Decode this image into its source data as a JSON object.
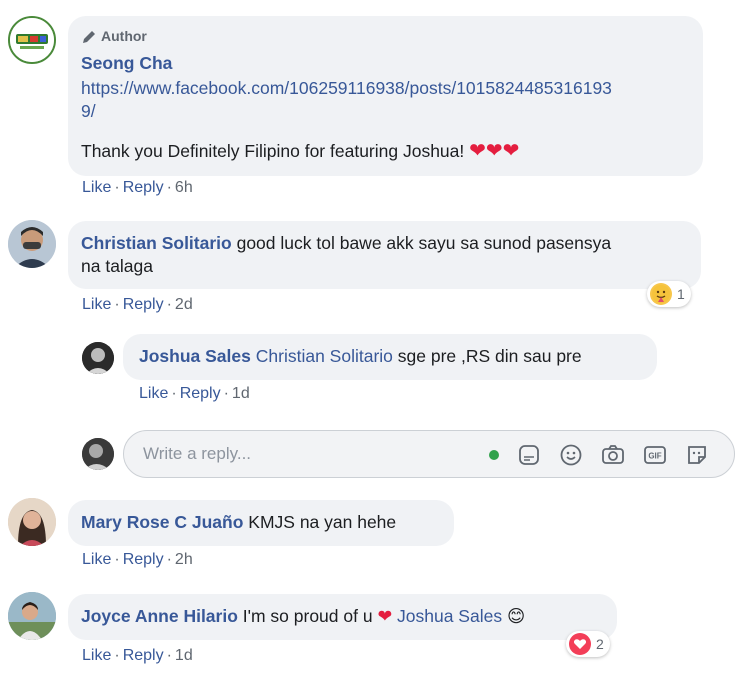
{
  "comments": [
    {
      "author_badge": "Author",
      "name": "Seong Cha",
      "link_line1": "https://www.facebook.com/106259116938/posts/1015824485316193",
      "link_line2": "9/",
      "text": "Thank you Definitely Filipino for featuring Joshua!",
      "hearts": "❤❤❤",
      "like": "Like",
      "reply": "Reply",
      "time": "6h"
    },
    {
      "name": "Christian Solitario",
      "text_line1": "good luck tol bawe akk sayu sa sunod pasensya",
      "text_line2": "na talaga",
      "like": "Like",
      "reply": "Reply",
      "time": "2d",
      "reaction_count": "1",
      "reply_item": {
        "name": "Joshua Sales",
        "mention": "Christian Solitario",
        "text": "sge pre ,RS din sau pre",
        "like": "Like",
        "reply": "Reply",
        "time": "1d"
      }
    },
    {
      "name": "Mary Rose C Juaño",
      "text": "KMJS na yan hehe",
      "like": "Like",
      "reply": "Reply",
      "time": "2h"
    },
    {
      "name": "Joyce Anne Hilario",
      "text": "I'm so proud of u",
      "heart": "❤",
      "mention": "Joshua Sales",
      "emoji": "😊",
      "like": "Like",
      "reply": "Reply",
      "time": "1d",
      "reaction_count": "2"
    }
  ],
  "reply_box": {
    "placeholder": "Write a reply...",
    "icons": [
      "sticker-icon",
      "emoji-icon",
      "camera-icon",
      "gif-icon",
      "sticker-pack-icon"
    ]
  },
  "colors": {
    "link": "#385898",
    "meta": "#606770",
    "bubble": "#f0f2f5",
    "online": "#31a24c"
  }
}
